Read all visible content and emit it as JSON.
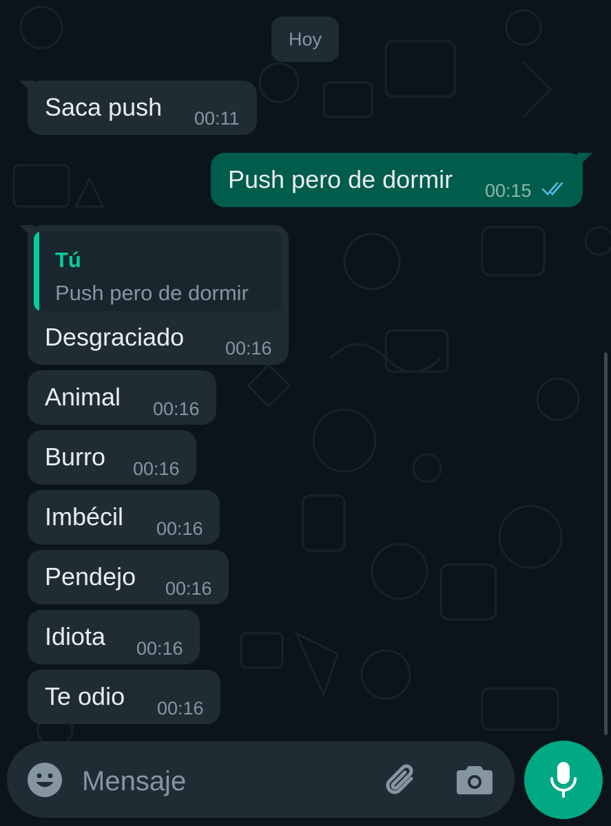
{
  "date_chip": "Hoy",
  "messages": [
    {
      "direction": "in",
      "text": "Saca push",
      "time": "00:11"
    },
    {
      "direction": "out",
      "text": "Push pero de dormir",
      "time": "00:15",
      "status": "read"
    },
    {
      "direction": "in",
      "text": "Desgraciado",
      "time": "00:16",
      "reply_to": {
        "author": "Tú",
        "text": "Push pero de dormir"
      }
    },
    {
      "direction": "in",
      "text": "Animal",
      "time": "00:16"
    },
    {
      "direction": "in",
      "text": "Burro",
      "time": "00:16"
    },
    {
      "direction": "in",
      "text": "Imbécil",
      "time": "00:16"
    },
    {
      "direction": "in",
      "text": "Pendejo",
      "time": "00:16"
    },
    {
      "direction": "in",
      "text": "Idiota",
      "time": "00:16"
    },
    {
      "direction": "in",
      "text": "Te odio",
      "time": "00:16"
    }
  ],
  "composer": {
    "placeholder": "Mensaje",
    "icons": [
      "emoji-icon",
      "attach-icon",
      "camera-icon",
      "mic-icon"
    ]
  },
  "colors": {
    "background": "#0b141a",
    "incoming_bubble": "#202c33",
    "outgoing_bubble": "#005c4b",
    "accent": "#00a884",
    "read_ticks": "#53bdeb"
  }
}
